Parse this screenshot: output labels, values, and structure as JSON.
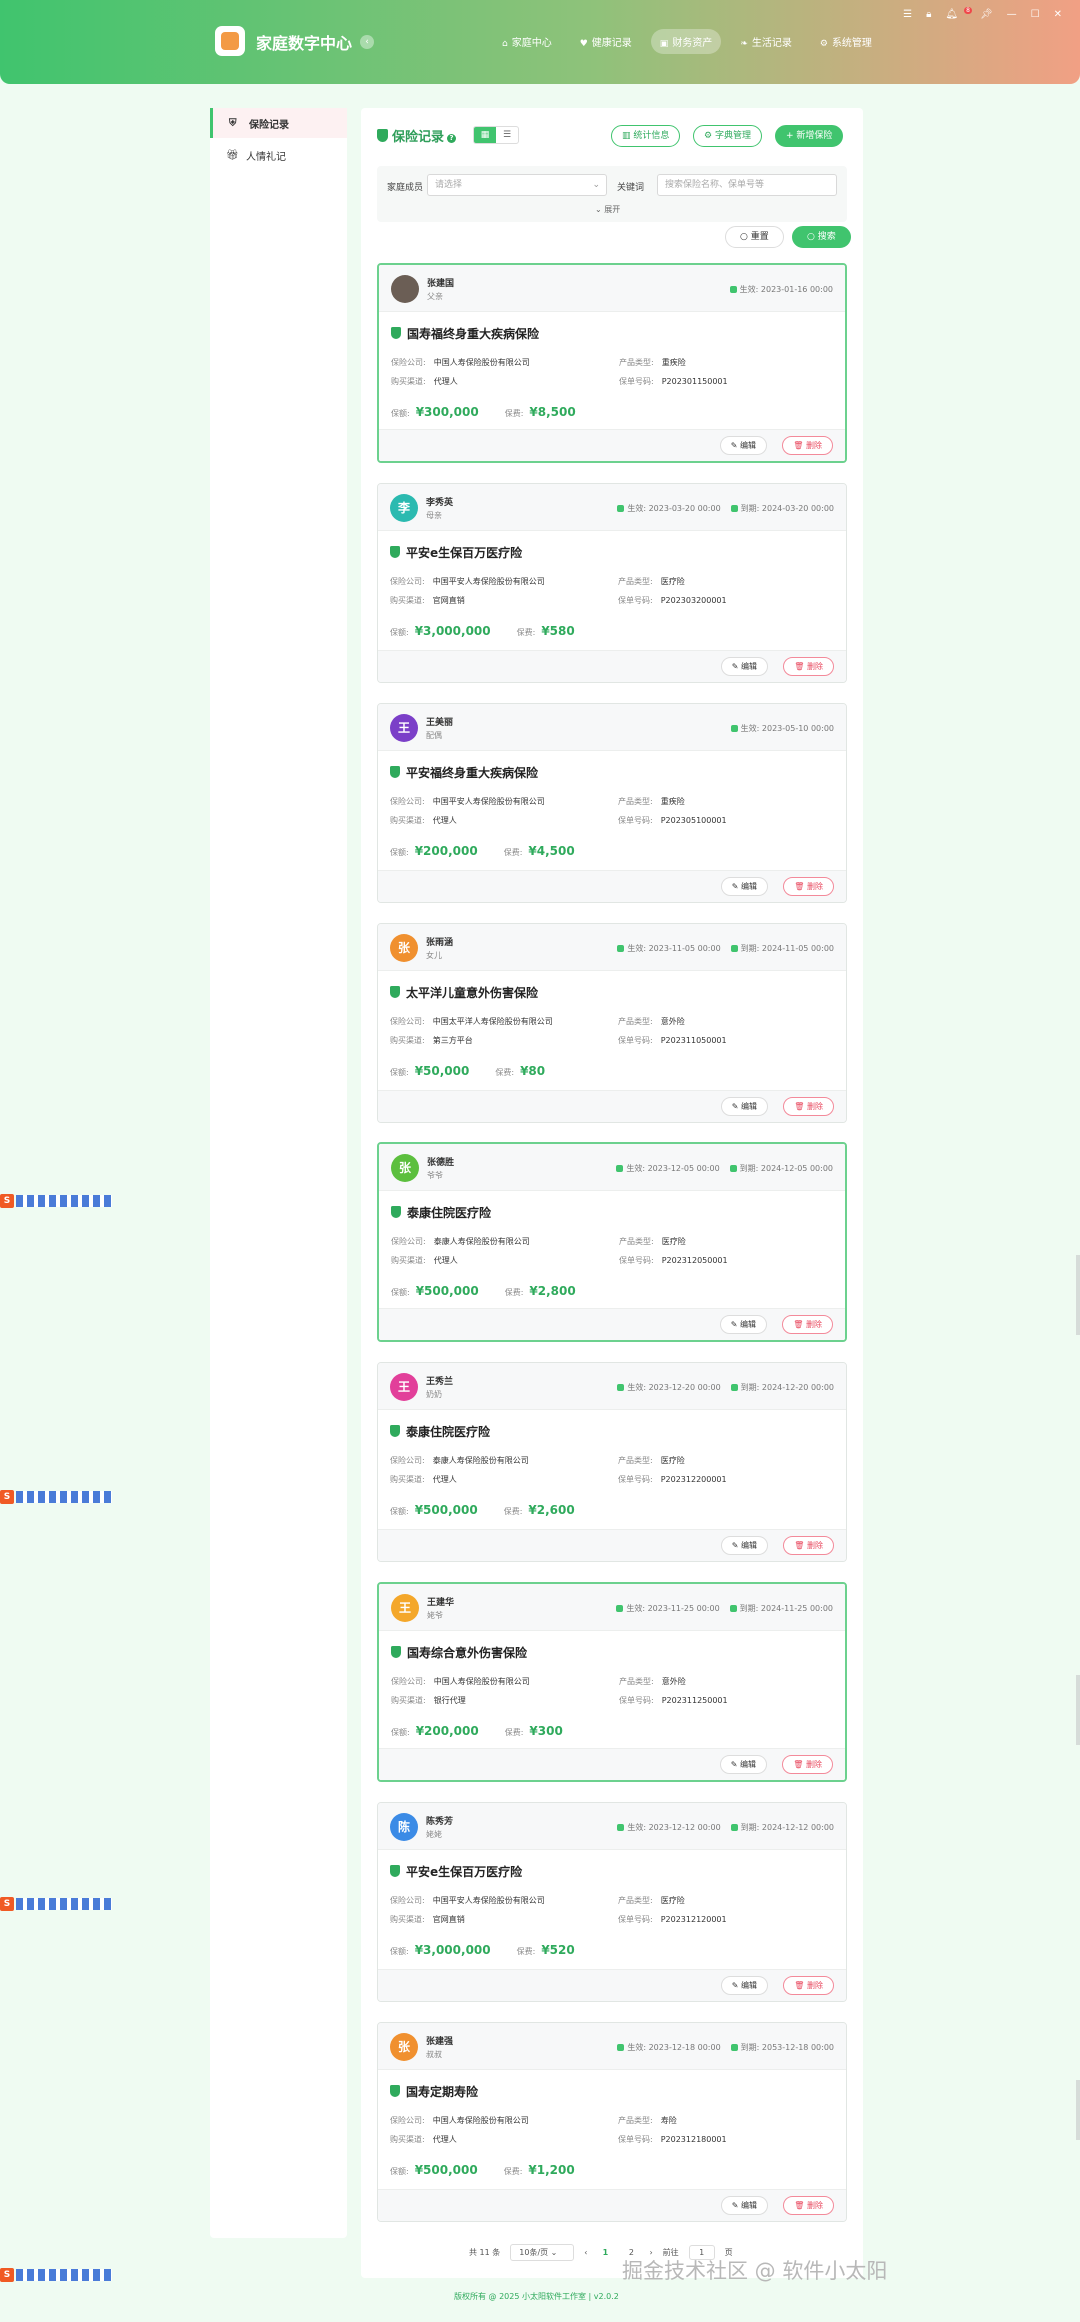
{
  "header": {
    "app_title": "家庭数字中心",
    "nav": [
      {
        "label": "家庭中心",
        "icon": "home-icon"
      },
      {
        "label": "健康记录",
        "icon": "heart-icon"
      },
      {
        "label": "财务资产",
        "icon": "wallet-icon",
        "active": true
      },
      {
        "label": "生活记录",
        "icon": "leaf-icon"
      },
      {
        "label": "系统管理",
        "icon": "gear-icon"
      }
    ],
    "notification_count": "8"
  },
  "sidebar": {
    "items": [
      {
        "label": "保险记录",
        "active": true
      },
      {
        "label": "人情礼记"
      }
    ]
  },
  "main": {
    "title": "保险记录",
    "stats_label": "统计信息",
    "dict_label": "字典管理",
    "add_label": "新增保险",
    "filter": {
      "member_label": "家庭成员",
      "member_placeholder": "请选择",
      "keyword_label": "关键词",
      "keyword_placeholder": "搜索保险名称、保单号等",
      "expand_label": "展开",
      "reset_label": "重置",
      "search_label": "搜索"
    }
  },
  "cards": [
    {
      "avatar": "",
      "name": "张建国",
      "relation": "父亲",
      "start": "生效: 2023-01-16 00:00",
      "end": "",
      "title": "国寿福终身重大疾病保险",
      "company": "中国人寿保险股份有限公司",
      "type": "重疾险",
      "channel": "代理人",
      "policy_no": "P202301150001",
      "coverage": "¥300,000",
      "premium": "¥8,500",
      "avatar_color": "#6b5e55"
    },
    {
      "avatar": "李",
      "name": "李秀英",
      "relation": "母亲",
      "start": "生效: 2023-03-20 00:00",
      "end": "到期: 2024-03-20 00:00",
      "title": "平安e生保百万医疗险",
      "company": "中国平安人寿保险股份有限公司",
      "type": "医疗险",
      "channel": "官网直销",
      "policy_no": "P202303200001",
      "coverage": "¥3,000,000",
      "premium": "¥580",
      "avatar_color": "#2bbab0"
    },
    {
      "avatar": "王",
      "name": "王美丽",
      "relation": "配偶",
      "start": "生效: 2023-05-10 00:00",
      "end": "",
      "title": "平安福终身重大疾病保险",
      "company": "中国平安人寿保险股份有限公司",
      "type": "重疾险",
      "channel": "代理人",
      "policy_no": "P202305100001",
      "coverage": "¥200,000",
      "premium": "¥4,500",
      "avatar_color": "#7b3fc8"
    },
    {
      "avatar": "张",
      "name": "张雨涵",
      "relation": "女儿",
      "start": "生效: 2023-11-05 00:00",
      "end": "到期: 2024-11-05 00:00",
      "title": "太平洋儿童意外伤害保险",
      "company": "中国太平洋人寿保险股份有限公司",
      "type": "意外险",
      "channel": "第三方平台",
      "policy_no": "P202311050001",
      "coverage": "¥50,000",
      "premium": "¥80",
      "avatar_color": "#f0902f"
    },
    {
      "avatar": "张",
      "name": "张德胜",
      "relation": "爷爷",
      "start": "生效: 2023-12-05 00:00",
      "end": "到期: 2024-12-05 00:00",
      "title": "泰康住院医疗险",
      "company": "泰康人寿保险股份有限公司",
      "type": "医疗险",
      "channel": "代理人",
      "policy_no": "P202312050001",
      "coverage": "¥500,000",
      "premium": "¥2,800",
      "avatar_color": "#5cbf3e"
    },
    {
      "avatar": "王",
      "name": "王秀兰",
      "relation": "奶奶",
      "start": "生效: 2023-12-20 00:00",
      "end": "到期: 2024-12-20 00:00",
      "title": "泰康住院医疗险",
      "company": "泰康人寿保险股份有限公司",
      "type": "医疗险",
      "channel": "代理人",
      "policy_no": "P202312200001",
      "coverage": "¥500,000",
      "premium": "¥2,600",
      "avatar_color": "#e23f9a"
    },
    {
      "avatar": "王",
      "name": "王建华",
      "relation": "姥爷",
      "start": "生效: 2023-11-25 00:00",
      "end": "到期: 2024-11-25 00:00",
      "title": "国寿综合意外伤害保险",
      "company": "中国人寿保险股份有限公司",
      "type": "意外险",
      "channel": "银行代理",
      "policy_no": "P202311250001",
      "coverage": "¥200,000",
      "premium": "¥300",
      "avatar_color": "#f4a72a"
    },
    {
      "avatar": "陈",
      "name": "陈秀芳",
      "relation": "姥姥",
      "start": "生效: 2023-12-12 00:00",
      "end": "到期: 2024-12-12 00:00",
      "title": "平安e生保百万医疗险",
      "company": "中国平安人寿保险股份有限公司",
      "type": "医疗险",
      "channel": "官网直销",
      "policy_no": "P202312120001",
      "coverage": "¥3,000,000",
      "premium": "¥520",
      "avatar_color": "#3b8be6"
    },
    {
      "avatar": "张",
      "name": "张建强",
      "relation": "叔叔",
      "start": "生效: 2023-12-18 00:00",
      "end": "到期: 2053-12-18 00:00",
      "title": "国寿定期寿险",
      "company": "中国人寿保险股份有限公司",
      "type": "寿险",
      "channel": "代理人",
      "policy_no": "P202312180001",
      "coverage": "¥500,000",
      "premium": "¥1,200",
      "avatar_color": "#f0902f"
    }
  ],
  "labels": {
    "company": "保险公司:",
    "type": "产品类型:",
    "channel": "购买渠道:",
    "policy_no": "保单号码:",
    "coverage": "保额:",
    "premium": "保费:",
    "edit": "编辑",
    "delete": "删除"
  },
  "pagination": {
    "total": "共 11 条",
    "page_size": "10条/页",
    "prev": "‹",
    "pages": [
      "1",
      "2"
    ],
    "next": "›",
    "goto_label": "前往",
    "goto_value": "1",
    "page_unit": "页"
  },
  "footer": "版权所有 @ 2025 小太阳软件工作室  |  v2.0.2",
  "watermark": "掘金技术社区 @ 软件小太阳",
  "ime_label": "S"
}
